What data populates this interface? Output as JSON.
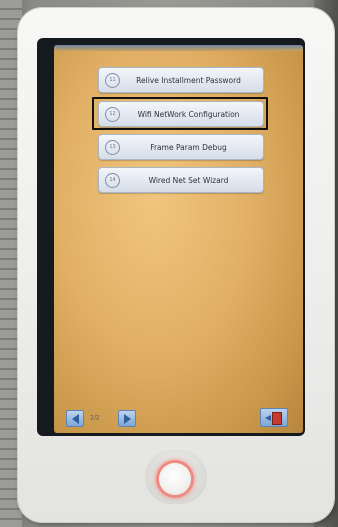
{
  "menu": {
    "items": [
      {
        "number": "11",
        "label": "Relive Installment Password",
        "selected": false
      },
      {
        "number": "12",
        "label": "Wifi NetWork Configuration",
        "selected": true
      },
      {
        "number": "13",
        "label": "Frame Param Debug",
        "selected": false
      },
      {
        "number": "14",
        "label": "Wired Net Set Wizard",
        "selected": false
      }
    ]
  },
  "pagination": {
    "page_text": "2/2"
  },
  "icons": {
    "prev": "arrow-left-icon",
    "next": "arrow-right-icon",
    "exit": "exit-door-icon",
    "home": "home-button-icon"
  },
  "colors": {
    "screen_background": "#e1b066",
    "button_face": "#d6dee8",
    "nav_button": "#7ea6d6",
    "selection_frame": "#111111",
    "home_ring": "#f08a80"
  }
}
